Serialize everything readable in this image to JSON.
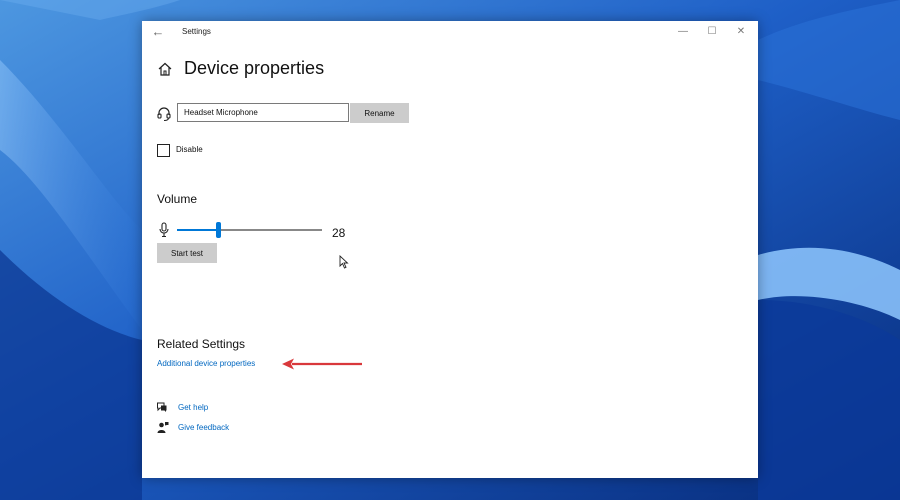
{
  "window": {
    "app_title": "Settings",
    "controls": {
      "back": "←",
      "minimize": "—",
      "maximize": "☐",
      "close": "✕"
    }
  },
  "page": {
    "title": "Device properties"
  },
  "device": {
    "name_value": "Headset Microphone",
    "rename_label": "Rename",
    "disable_label": "Disable",
    "disable_checked": false
  },
  "volume": {
    "heading": "Volume",
    "value": "28",
    "level": 28,
    "start_test_label": "Start test"
  },
  "related": {
    "heading": "Related Settings",
    "additional_link": "Additional device properties"
  },
  "help": {
    "get_help": "Get help",
    "give_feedback": "Give feedback"
  },
  "icons": {
    "home": "home-icon",
    "headset": "headset-icon",
    "microphone": "microphone-icon",
    "help": "help-chat-icon",
    "feedback": "feedback-person-icon"
  },
  "colors": {
    "accent": "#0078d7",
    "link": "#0067c0",
    "annotation_arrow": "#d9383b",
    "button_bg": "#cccccc"
  }
}
